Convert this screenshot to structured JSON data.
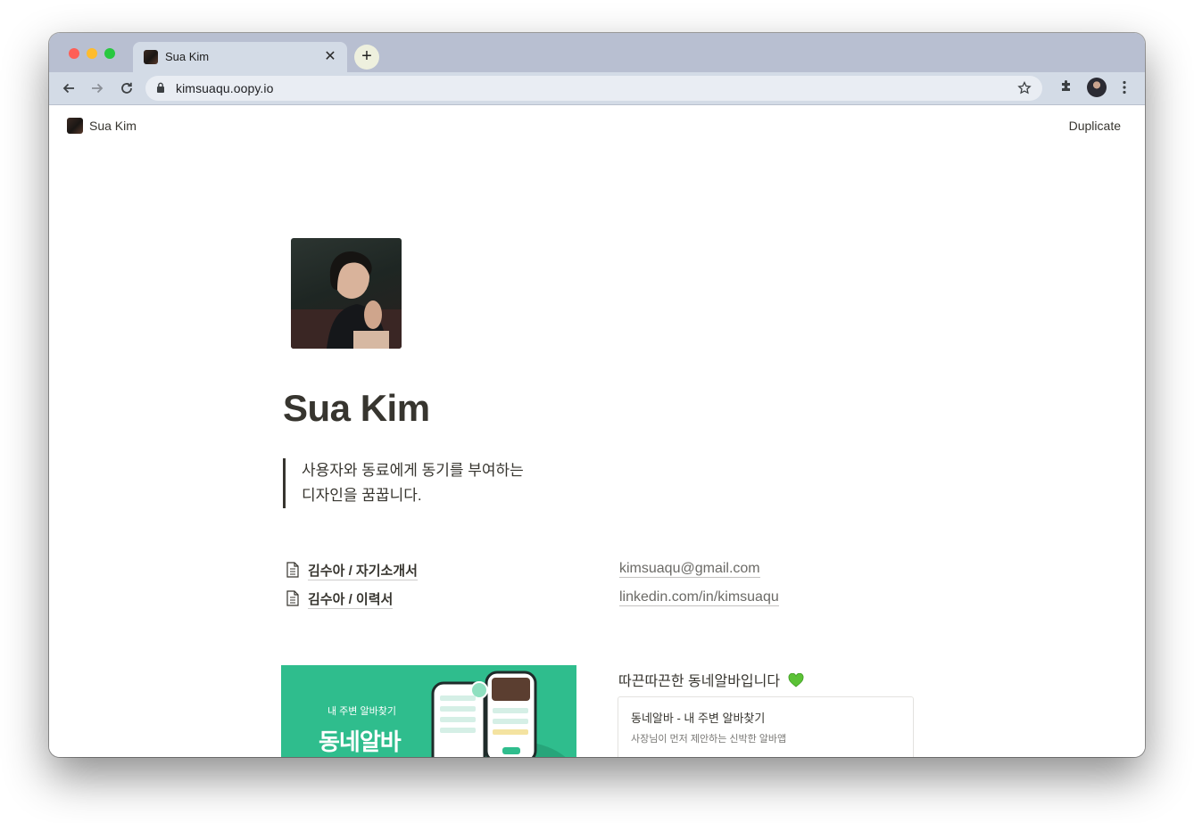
{
  "browser": {
    "tab_title": "Sua Kim",
    "tab_close": "✕",
    "new_tab": "+",
    "url": "kimsuaqu.oopy.io",
    "icons": [
      "back-arrow-icon",
      "forward-arrow-icon",
      "reload-icon",
      "lock-icon",
      "star-icon",
      "extensions-puzzle-icon",
      "profile-avatar",
      "more-menu-icon"
    ]
  },
  "site": {
    "name": "Sua Kim",
    "duplicate_label": "Duplicate"
  },
  "profile": {
    "title": "Sua Kim",
    "quote_line1": "사용자와 동료에게 동기를 부여하는",
    "quote_line2": "디자인을 꿈꿉니다."
  },
  "links": {
    "documents": [
      {
        "label": "김수아 / 자기소개서"
      },
      {
        "label": "김수아 / 이력서"
      }
    ],
    "external": [
      {
        "label": "kimsuaqu@gmail.com"
      },
      {
        "label": "linkedin.com/in/kimsuaqu"
      }
    ]
  },
  "project": {
    "banner_subtitle": "내 주변 알바찾기",
    "banner_title": "동네알바",
    "heading": "따끈따끈한 동네알바입니다",
    "heading_emoji": "green-heart-icon",
    "bookmark_title": "동네알바 - 내 주변 알바찾기",
    "bookmark_desc": "사장님이 먼저 제안하는 신박한 알바앱"
  },
  "colors": {
    "tabbar": "#b8bfd1",
    "toolbar": "#d3dbe6",
    "text": "#37352f",
    "banner_green": "#2fbd8d",
    "heart": "#5bc236"
  }
}
